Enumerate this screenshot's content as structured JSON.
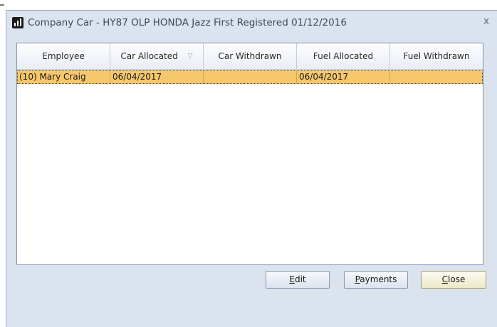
{
  "window": {
    "title": "Company Car - HY87 OLP HONDA Jazz First Registered 01/12/2016",
    "close_glyph": "x"
  },
  "grid": {
    "columns": [
      {
        "label": "Employee"
      },
      {
        "label": "Car Allocated",
        "sort_icon": "▽"
      },
      {
        "label": "Car Withdrawn"
      },
      {
        "label": "Fuel Allocated"
      },
      {
        "label": "Fuel Withdrawn"
      }
    ],
    "rows": [
      {
        "employee": "(10) Mary Craig",
        "car_allocated": "06/04/2017",
        "car_withdrawn": "",
        "fuel_allocated": "06/04/2017",
        "fuel_withdrawn": ""
      }
    ],
    "selected_row_color": "#f7c76c"
  },
  "buttons": {
    "edit": {
      "mnemonic": "E",
      "rest": "dit"
    },
    "payments": {
      "mnemonic": "P",
      "rest": "ayments"
    },
    "close": {
      "mnemonic": "C",
      "rest": "lose"
    }
  },
  "icons": {
    "app": "bar-chart-icon",
    "window_close": "close-icon",
    "sort": "sort-descending-icon"
  }
}
